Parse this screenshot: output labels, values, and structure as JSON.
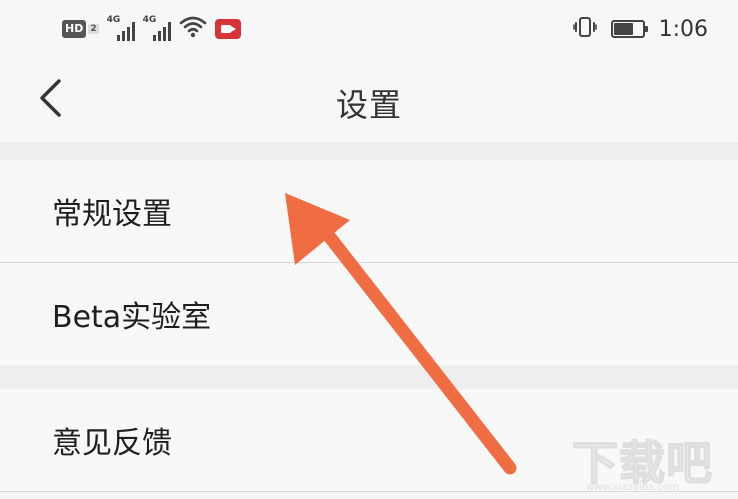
{
  "status_bar": {
    "hd_label": "HD",
    "hd_sub": "2",
    "sim1_label": "4G",
    "sim2_label": "4G",
    "time": "1:06",
    "battery_level": 0.7,
    "icons": [
      "hd-volte-icon",
      "signal-icon",
      "signal-icon",
      "wifi-icon",
      "screen-record-icon",
      "vibrate-icon",
      "battery-icon"
    ]
  },
  "nav": {
    "title": "设置",
    "back_icon": "chevron-left-icon"
  },
  "settings": {
    "items": [
      {
        "label": "常规设置"
      },
      {
        "label": "Beta实验室"
      },
      {
        "label": "意见反馈"
      }
    ]
  },
  "annotation": {
    "arrow_color": "#f06d44"
  },
  "watermark": {
    "text": "下载吧",
    "url": "www.xiazaiba.com"
  }
}
